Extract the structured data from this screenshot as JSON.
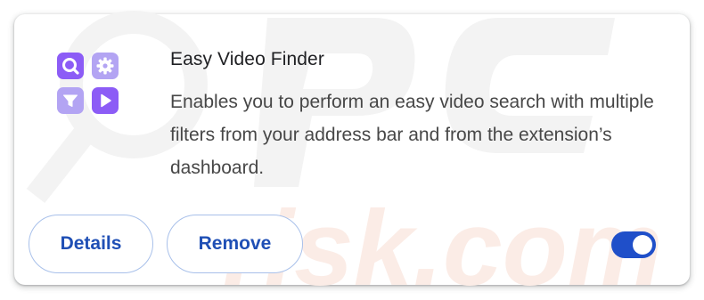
{
  "extension": {
    "icon": {
      "tiles": [
        "search-icon",
        "gear-icon",
        "filter-icon",
        "play-icon"
      ],
      "colors": {
        "primary": "#8c5cf6",
        "secondary": "#b3a4f3"
      }
    },
    "name": "Easy Video Finder",
    "description": "Enables you to perform an easy video search with multiple filters from your address bar and from the extension’s dashboard."
  },
  "actions": {
    "details_label": "Details",
    "remove_label": "Remove"
  },
  "toggle": {
    "enabled": true,
    "color": "#1f4fc9"
  },
  "watermark": {
    "text": "risk.com",
    "color": "#f6ddd2"
  }
}
